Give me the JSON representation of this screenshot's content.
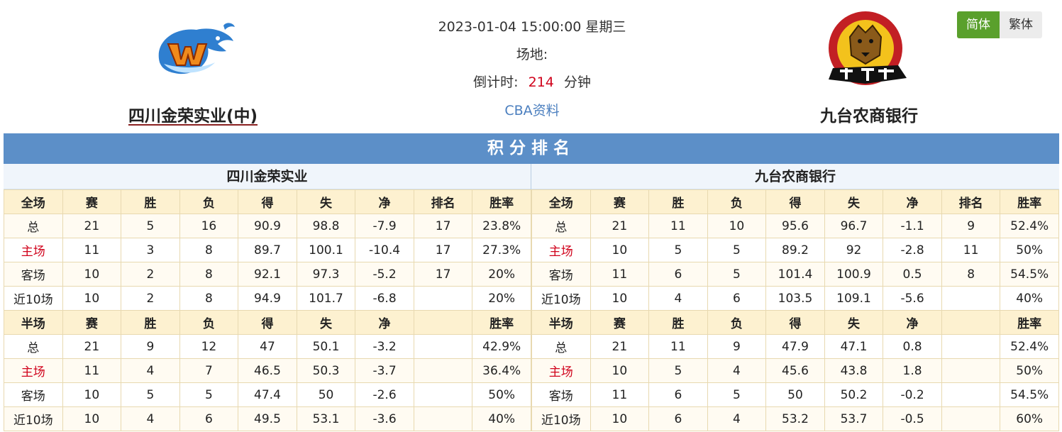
{
  "match": {
    "datetime": "2023-01-04 15:00:00 星期三",
    "venue_label": "场地:",
    "countdown_label": "倒计时:",
    "countdown_value": "214",
    "countdown_unit": "分钟",
    "cba_link": "CBA资料"
  },
  "home_team": {
    "name": "四川金荣实业(中)",
    "logo": "sichuan-whale-logo"
  },
  "away_team": {
    "name": "九台农商银行",
    "logo": "jilin-tiger-logo"
  },
  "lang": {
    "simplified": "简体",
    "traditional": "繁体"
  },
  "colors": {
    "title_bar": "#5c8fc8",
    "accent_red": "#d0021b",
    "lang_active": "#5aa02c",
    "header_row": "#fdf1d0"
  },
  "standings": {
    "title": "积分排名",
    "left": {
      "team": "四川金荣实业",
      "full": {
        "headers": [
          "全场",
          "赛",
          "胜",
          "负",
          "得",
          "失",
          "净",
          "排名",
          "胜率"
        ],
        "rows": [
          [
            "总",
            "21",
            "5",
            "16",
            "90.9",
            "98.8",
            "-7.9",
            "17",
            "23.8%"
          ],
          [
            "主场",
            "11",
            "3",
            "8",
            "89.7",
            "100.1",
            "-10.4",
            "17",
            "27.3%"
          ],
          [
            "客场",
            "10",
            "2",
            "8",
            "92.1",
            "97.3",
            "-5.2",
            "17",
            "20%"
          ],
          [
            "近10场",
            "10",
            "2",
            "8",
            "94.9",
            "101.7",
            "-6.8",
            "",
            "20%"
          ]
        ]
      },
      "half": {
        "headers": [
          "半场",
          "赛",
          "胜",
          "负",
          "得",
          "失",
          "净",
          "",
          "胜率"
        ],
        "rows": [
          [
            "总",
            "21",
            "9",
            "12",
            "47",
            "50.1",
            "-3.2",
            "",
            "42.9%"
          ],
          [
            "主场",
            "11",
            "4",
            "7",
            "46.5",
            "50.3",
            "-3.7",
            "",
            "36.4%"
          ],
          [
            "客场",
            "10",
            "5",
            "5",
            "47.4",
            "50",
            "-2.6",
            "",
            "50%"
          ],
          [
            "近10场",
            "10",
            "4",
            "6",
            "49.5",
            "53.1",
            "-3.6",
            "",
            "40%"
          ]
        ]
      }
    },
    "right": {
      "team": "九台农商银行",
      "full": {
        "headers": [
          "全场",
          "赛",
          "胜",
          "负",
          "得",
          "失",
          "净",
          "排名",
          "胜率"
        ],
        "rows": [
          [
            "总",
            "21",
            "11",
            "10",
            "95.6",
            "96.7",
            "-1.1",
            "9",
            "52.4%"
          ],
          [
            "主场",
            "10",
            "5",
            "5",
            "89.2",
            "92",
            "-2.8",
            "11",
            "50%"
          ],
          [
            "客场",
            "11",
            "6",
            "5",
            "101.4",
            "100.9",
            "0.5",
            "8",
            "54.5%"
          ],
          [
            "近10场",
            "10",
            "4",
            "6",
            "103.5",
            "109.1",
            "-5.6",
            "",
            "40%"
          ]
        ]
      },
      "half": {
        "headers": [
          "半场",
          "赛",
          "胜",
          "负",
          "得",
          "失",
          "净",
          "",
          "胜率"
        ],
        "rows": [
          [
            "总",
            "21",
            "11",
            "9",
            "47.9",
            "47.1",
            "0.8",
            "",
            "52.4%"
          ],
          [
            "主场",
            "10",
            "5",
            "4",
            "45.6",
            "43.8",
            "1.8",
            "",
            "50%"
          ],
          [
            "客场",
            "11",
            "6",
            "5",
            "50",
            "50.2",
            "-0.2",
            "",
            "54.5%"
          ],
          [
            "近10场",
            "10",
            "6",
            "4",
            "53.2",
            "53.7",
            "-0.5",
            "",
            "60%"
          ]
        ]
      }
    }
  }
}
